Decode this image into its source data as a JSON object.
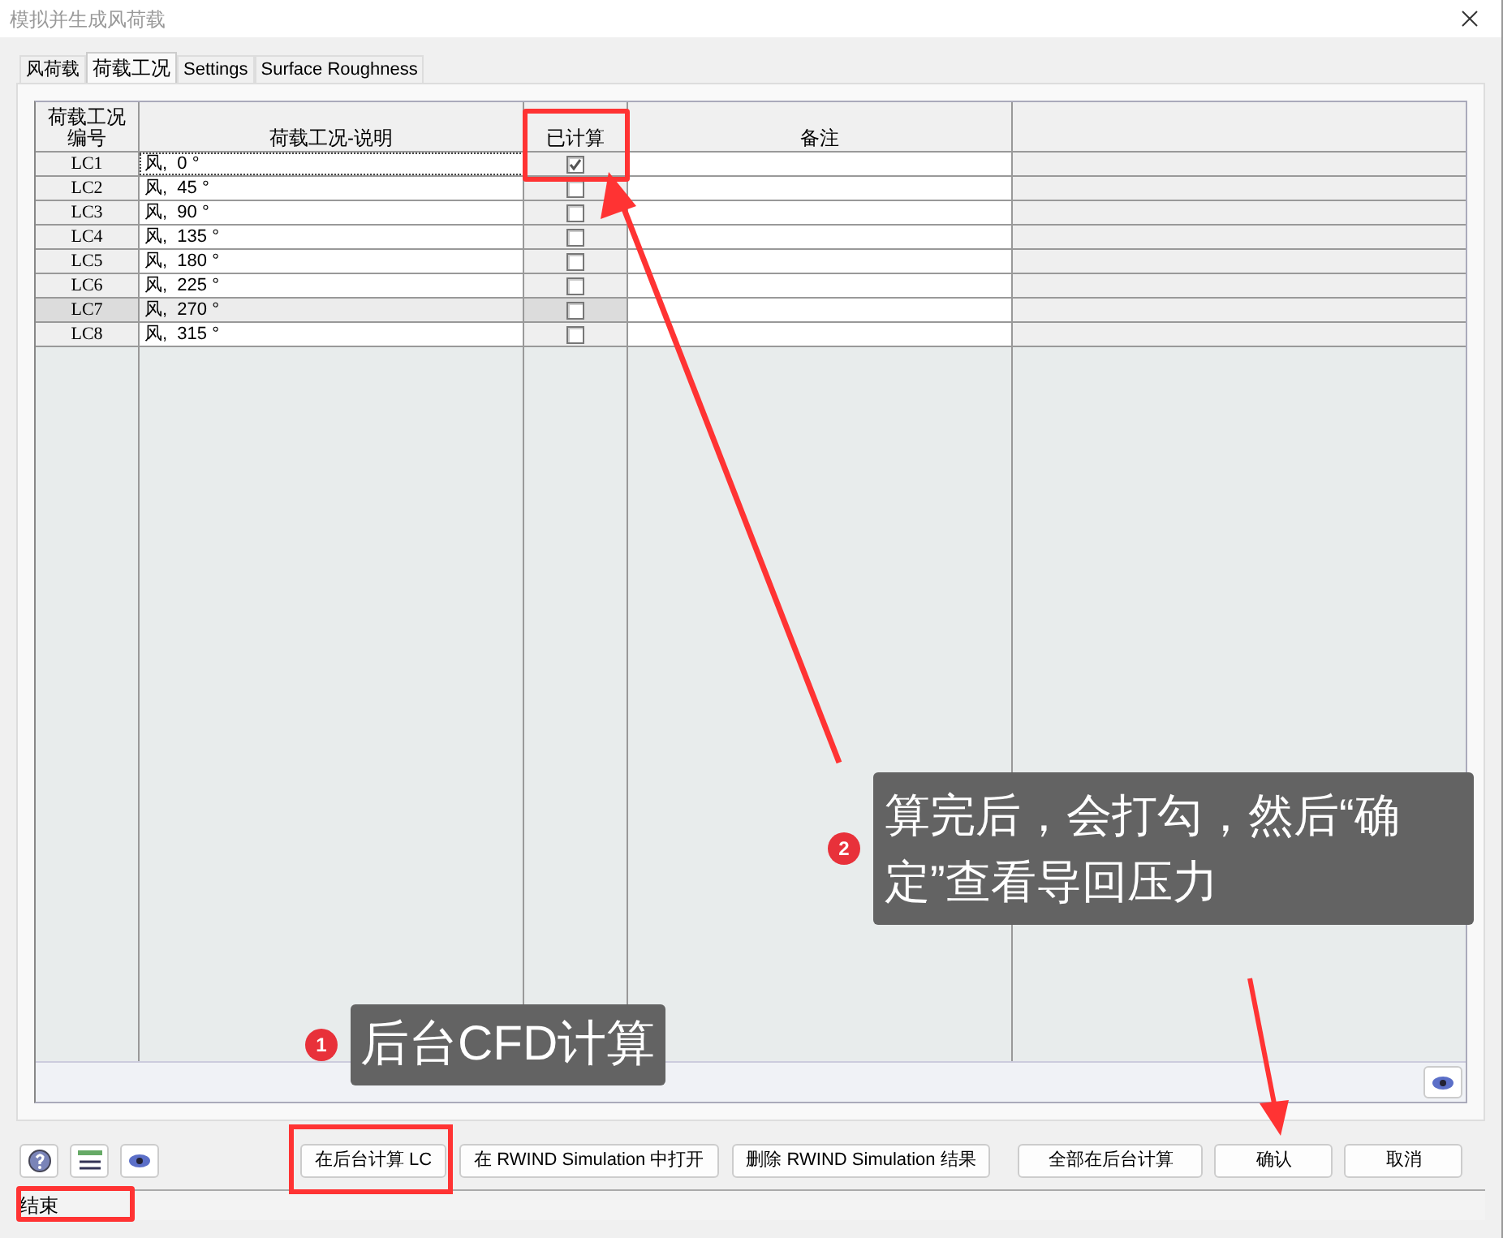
{
  "window": {
    "title": "模拟并生成风荷载"
  },
  "tabs": [
    {
      "label": "风荷载",
      "selected": false
    },
    {
      "label": "荷载工况",
      "selected": true
    },
    {
      "label": "Settings",
      "selected": false
    },
    {
      "label": "Surface Roughness",
      "selected": false
    }
  ],
  "table": {
    "columns": [
      "荷载工况编号",
      "荷载工况-说明",
      "已计算",
      "备注"
    ],
    "rows": [
      {
        "id": "LC1",
        "description": "风, 0 °",
        "calculated": true,
        "selected": false,
        "focused": true
      },
      {
        "id": "LC2",
        "description": "风, 45 °",
        "calculated": false,
        "selected": false,
        "focused": false
      },
      {
        "id": "LC3",
        "description": "风, 90 °",
        "calculated": false,
        "selected": false,
        "focused": false
      },
      {
        "id": "LC4",
        "description": "风, 135 °",
        "calculated": false,
        "selected": false,
        "focused": false
      },
      {
        "id": "LC5",
        "description": "风, 180 °",
        "calculated": false,
        "selected": false,
        "focused": false
      },
      {
        "id": "LC6",
        "description": "风, 225 °",
        "calculated": false,
        "selected": false,
        "focused": false
      },
      {
        "id": "LC7",
        "description": "风, 270 °",
        "calculated": false,
        "selected": true,
        "focused": false
      },
      {
        "id": "LC8",
        "description": "风, 315 °",
        "calculated": false,
        "selected": false,
        "focused": false
      }
    ]
  },
  "buttons": [
    "在后台计算 LC",
    "在 RWIND Simulation 中打开",
    "删除 RWIND Simulation 结果",
    "全部在后台计算",
    "确认",
    "取消"
  ],
  "status_bar": "结束",
  "annotations": [
    {
      "number": "1",
      "text": "后台CFD计算"
    },
    {
      "number": "2",
      "text": "算完后，会打勾，然后“确定”查看导回压力"
    }
  ]
}
